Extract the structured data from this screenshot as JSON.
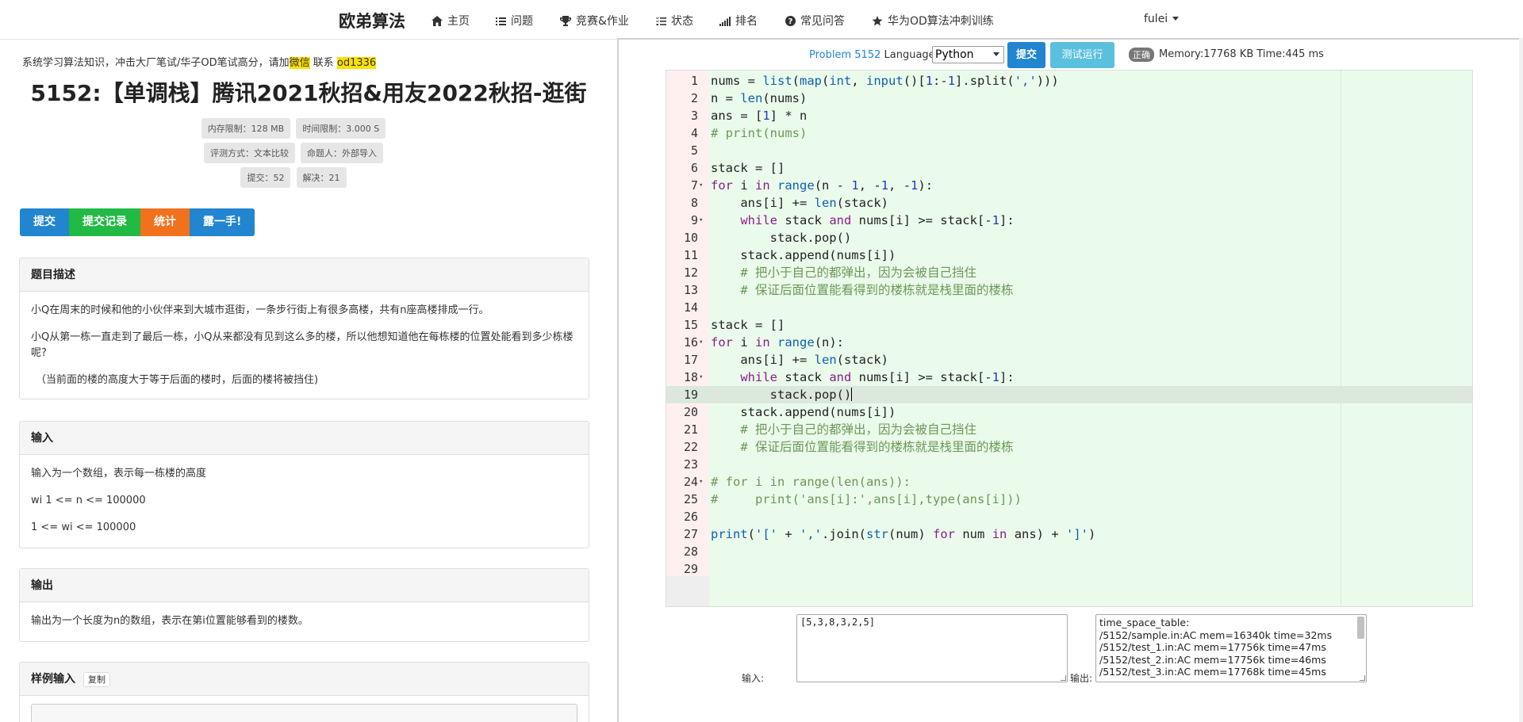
{
  "nav": {
    "brand": "欧弟算法",
    "items": [
      {
        "label": "主页",
        "icon": "home-icon"
      },
      {
        "label": "问题",
        "icon": "list-icon"
      },
      {
        "label": "竞赛&作业",
        "icon": "trophy-icon"
      },
      {
        "label": "状态",
        "icon": "tasks-icon"
      },
      {
        "label": "排名",
        "icon": "bars-icon"
      },
      {
        "label": "常见问答",
        "icon": "question-icon"
      },
      {
        "label": "华为OD算法冲刺训练",
        "icon": "star-icon"
      }
    ],
    "user": "fulei"
  },
  "notice": {
    "before": "系统学习算法知识，冲击大厂笔试/华子OD笔试高分，请加",
    "wechat": "微信",
    "middle": " 联系 ",
    "contact": "od1336"
  },
  "problem": {
    "title": "5152:【单调栈】腾讯2021秋招&用友2022秋招-逛街",
    "badges": {
      "memory": "内存限制：128 MB",
      "time": "时间限制：3.000 S",
      "judge": "评测方式：文本比较",
      "author": "命题人：外部导入",
      "submitted": "提交：52",
      "solved": "解决：21"
    },
    "buttons": {
      "submit": "提交",
      "records": "提交记录",
      "stats": "统计",
      "hint": "露一手!"
    },
    "description": {
      "header": "题目描述",
      "p1": "小Q在周末的时候和他的小伙伴来到大城市逛街，一条步行街上有很多高楼，共有n座高楼排成一行。",
      "p2": "小Q从第一栋一直走到了最后一栋，小Q从来都没有见到这么多的楼，所以他想知道他在每栋楼的位置处能看到多少栋楼呢?",
      "p3": "（当前面的楼的高度大于等于后面的楼时，后面的楼将被挡住)"
    },
    "input": {
      "header": "输入",
      "p1": "输入为一个数组，表示每一栋楼的高度",
      "p2": "wi 1 <= n <= 100000",
      "p3": "1 <= wi <= 100000"
    },
    "output": {
      "header": "输出",
      "p1": "输出为一个长度为n的数组，表示在第i位置能够看到的楼数。"
    },
    "sample_input": {
      "header": "样例输入",
      "copy": "复制"
    }
  },
  "toolbar": {
    "problem_prefix": "Problem ",
    "problem_id": "5152",
    "language_label": " Language:",
    "language": "Python",
    "submit": "提交",
    "test_run": "测试运行",
    "status": "正确",
    "metrics": "Memory:17768 KB  Time:445 ms"
  },
  "editor": {
    "active_line": 19,
    "lines": [
      "nums = list(map(int, input()[1:-1].split(',')))",
      "n = len(nums)",
      "ans = [1] * n",
      "# print(nums)",
      "",
      "stack = []",
      "for i in range(n - 1, -1, -1):",
      "    ans[i] += len(stack)",
      "    while stack and nums[i] >= stack[-1]:",
      "        stack.pop()",
      "    stack.append(nums[i])",
      "    # 把小于自己的都弹出，因为会被自己挡住",
      "    # 保证后面位置能看得到的楼栋就是栈里面的楼栋",
      "",
      "stack = []",
      "for i in range(n):",
      "    ans[i] += len(stack)",
      "    while stack and nums[i] >= stack[-1]:",
      "        stack.pop()",
      "    stack.append(nums[i])",
      "    # 把小于自己的都弹出，因为会被自己挡住",
      "    # 保证后面位置能看得到的楼栋就是栈里面的楼栋",
      "",
      "# for i in range(len(ans)):",
      "#     print('ans[i]:',ans[i],type(ans[i]))",
      "",
      "print('[' + ','.join(str(num) for num in ans) + ']')",
      "",
      ""
    ],
    "fold_lines": [
      7,
      9,
      16,
      18,
      24
    ]
  },
  "io": {
    "input_label": "输入:",
    "input_value": "[5,3,8,3,2,5]",
    "output_label": "输出:",
    "output_lines": [
      "time_space_table:",
      "/5152/sample.in:AC mem=16340k time=32ms",
      "/5152/test_1.in:AC mem=17756k time=47ms",
      "/5152/test_2.in:AC mem=17756k time=46ms",
      "/5152/test_3.in:AC mem=17768k time=45ms"
    ]
  }
}
